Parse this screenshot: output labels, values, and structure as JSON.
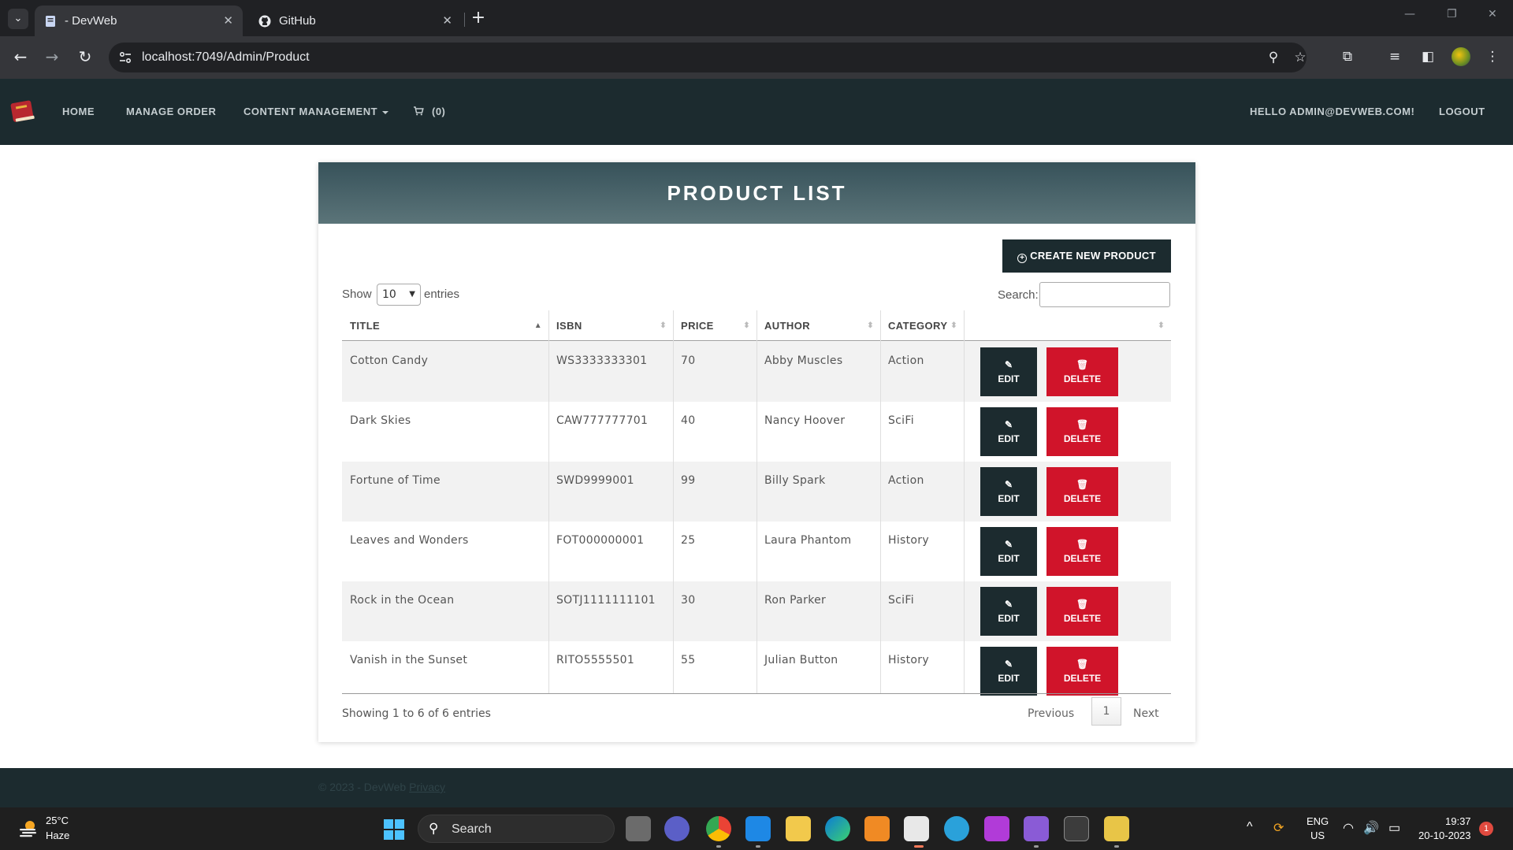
{
  "browser": {
    "tabs": [
      {
        "title": "- DevWeb",
        "active": true,
        "icon": "page-icon"
      },
      {
        "title": "GitHub",
        "active": false,
        "icon": "github-icon"
      }
    ],
    "url": "localhost:7049/Admin/Product"
  },
  "navbar": {
    "links": {
      "home": "HOME",
      "manage_order": "MANAGE ORDER",
      "content_management": "CONTENT MANAGEMENT",
      "cart": "(0)"
    },
    "greeting": "HELLO ADMIN@DEVWEB.COM!",
    "logout": "LOGOUT"
  },
  "page": {
    "title": "PRODUCT LIST",
    "create_button": "CREATE NEW PRODUCT",
    "length": {
      "show": "Show",
      "value": "10",
      "entries": "entries"
    },
    "search_label": "Search:",
    "columns": [
      "TITLE",
      "ISBN",
      "PRICE",
      "AUTHOR",
      "CATEGORY"
    ],
    "edit_label": "EDIT",
    "delete_label": "DELETE",
    "rows": [
      {
        "title": "Cotton Candy",
        "isbn": "WS3333333301",
        "price": "70",
        "author": "Abby Muscles",
        "category": "Action"
      },
      {
        "title": "Dark Skies",
        "isbn": "CAW777777701",
        "price": "40",
        "author": "Nancy Hoover",
        "category": "SciFi"
      },
      {
        "title": "Fortune of Time",
        "isbn": "SWD9999001",
        "price": "99",
        "author": "Billy Spark",
        "category": "Action"
      },
      {
        "title": "Leaves and Wonders",
        "isbn": "FOT000000001",
        "price": "25",
        "author": "Laura Phantom",
        "category": "History"
      },
      {
        "title": "Rock in the Ocean",
        "isbn": "SOTJ1111111101",
        "price": "30",
        "author": "Ron Parker",
        "category": "SciFi"
      },
      {
        "title": "Vanish in the Sunset",
        "isbn": "RITO5555501",
        "price": "55",
        "author": "Julian Button",
        "category": "History"
      }
    ],
    "info": "Showing 1 to 6 of 6 entries",
    "pagination": {
      "previous": "Previous",
      "current": "1",
      "next": "Next"
    }
  },
  "footer": {
    "text": "© 2023 - DevWeb",
    "link": "Privacy"
  },
  "taskbar": {
    "weather": {
      "temp": "25°C",
      "desc": "Haze"
    },
    "search": "Search",
    "lang": "ENG",
    "region": "US",
    "time": "19:37",
    "date": "20-10-2023",
    "notifications": "1"
  },
  "colors": {
    "navbar_bg": "#1c2b2f",
    "header_gradient_top": "#37525a",
    "delete_red": "#d0142a",
    "row_stripe": "#f2f2f2"
  }
}
